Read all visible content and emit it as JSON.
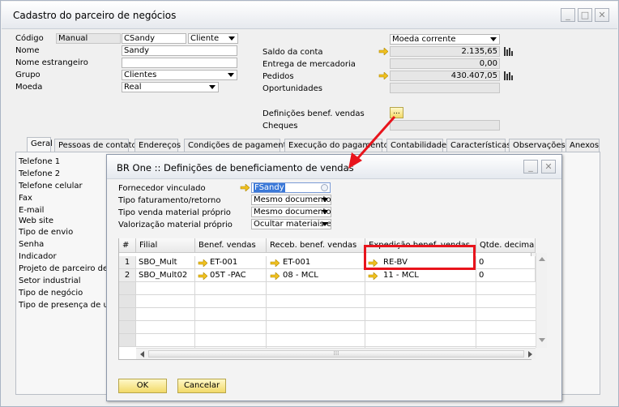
{
  "main": {
    "title": "Cadastro do parceiro de negócios",
    "fields": {
      "codigo_label": "Código",
      "codigo_series": "Manual",
      "codigo_value": "CSandy",
      "tipo_value": "Cliente",
      "nome_label": "Nome",
      "nome_value": "Sandy",
      "nome_estr_label": "Nome estrangeiro",
      "nome_estr_value": "",
      "grupo_label": "Grupo",
      "grupo_value": "Clientes",
      "moeda_label": "Moeda",
      "moeda_value": "Real"
    },
    "right": {
      "moeda_corrente": "Moeda corrente",
      "saldo_label": "Saldo da conta",
      "saldo_value": "2.135,65",
      "entrega_label": "Entrega de mercadoria",
      "entrega_value": "0,00",
      "pedidos_label": "Pedidos",
      "pedidos_value": "430.407,05",
      "oportunidades_label": "Oportunidades",
      "oportunidades_value": "",
      "def_label": "Definições benef. vendas",
      "def_button": "...",
      "cheques_label": "Cheques",
      "cheques_value": ""
    },
    "tabs": [
      "Geral",
      "Pessoas de contato",
      "Endereços",
      "Condições de pagamento",
      "Execução do pagamento",
      "Contabilidade",
      "Características",
      "Observações",
      "Anexos"
    ],
    "side_labels": [
      "Telefone 1",
      "Telefone 2",
      "Telefone celular",
      "Fax",
      "E-mail",
      "Web site",
      "Tipo de envio",
      "Senha",
      "Indicador",
      "Projeto de parceiro de n",
      "Setor industrial",
      "Tipo de negócio",
      "Tipo de presença de usu"
    ]
  },
  "dialog": {
    "title": "BR One :: Definições de beneficiamento de vendas",
    "fields": [
      {
        "label": "Fornecedor vinculado",
        "value": "FSandy"
      },
      {
        "label": "Tipo faturamento/retorno",
        "value": "Mesmo documento"
      },
      {
        "label": "Tipo venda material próprio",
        "value": "Mesmo documento"
      },
      {
        "label": "Valorização material próprio",
        "value": "Ocultar materiais e a"
      }
    ],
    "grid": {
      "columns": [
        "#",
        "Filial",
        "Benef. vendas",
        "Receb. benef. vendas",
        "Expedição benef. vendas",
        "Qtde. decimais"
      ],
      "rows": [
        {
          "n": "1",
          "filial": "SBO_Mult",
          "benef": "ET-001",
          "receb": "ET-001",
          "exped": "RE-BV",
          "qtde": "0"
        },
        {
          "n": "2",
          "filial": "SBO_Mult02",
          "benef": "05T -PAC",
          "receb": "08 - MCL",
          "exped": "11 - MCL",
          "qtde": "0"
        }
      ]
    },
    "ok_label": "OK",
    "cancel_label": "Cancelar"
  },
  "colors": {
    "highlight_box": "#e8141c",
    "arrow": "#e8141c",
    "link_arrow": "#f0c020",
    "selected_field": "#3a78d8"
  }
}
